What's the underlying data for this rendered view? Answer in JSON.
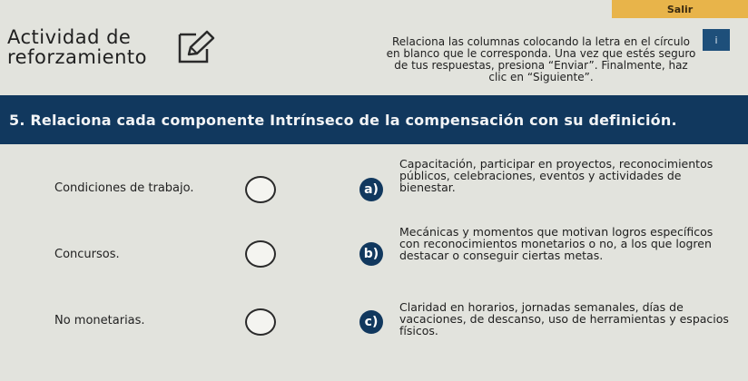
{
  "header": {
    "exit_label": "Salir",
    "title": "Actividad de reforzamiento",
    "instructions": "Relaciona las columnas colocando la letra en el círculo en blanco que le corresponda. Una vez que estés seguro de tus respuestas, presiona “Enviar”. Finalmente, haz clic en “Siguiente”.",
    "info_label": "i"
  },
  "question": {
    "text": "5. Relaciona cada componente Intrínseco de la compensación con su definición."
  },
  "rows": [
    {
      "label": "Condiciones de trabajo.",
      "letter": "a)",
      "definition": "Capacitación, participar en proyectos, reconocimientos públicos, celebraciones, eventos y actividades de bienestar."
    },
    {
      "label": "Concursos.",
      "letter": "b)",
      "definition": "Mecánicas y momentos que motivan logros específicos con reconocimientos monetarios o no, a los que logren destacar o conseguir ciertas metas."
    },
    {
      "label": "No monetarias.",
      "letter": "c)",
      "definition": "Claridad en horarios, jornadas semanales, días de vacaciones, de descanso, uso de herramientas y espacios físicos."
    }
  ],
  "icons": {
    "pencil": "pencil-edit-icon",
    "info": "info-icon"
  },
  "colors": {
    "accent_navy": "#11385e",
    "exit_orange": "#e8b44a",
    "background": "#e2e3dd"
  }
}
